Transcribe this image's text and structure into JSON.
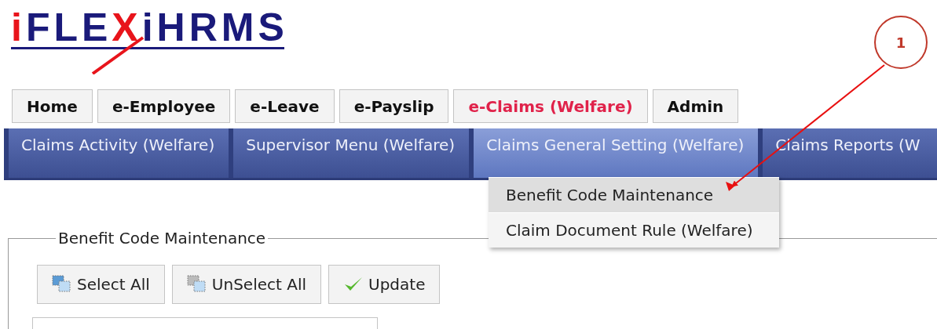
{
  "logo": {
    "parts": [
      {
        "text": "i",
        "color": "#e8141b"
      },
      {
        "text": "FLE",
        "color": "#1a1a7a"
      },
      {
        "text": "X",
        "color": "#e8141b"
      },
      {
        "text": "iHRMS",
        "color": "#1a1a7a"
      }
    ]
  },
  "main_tabs": [
    {
      "label": "Home",
      "selected": false
    },
    {
      "label": "e-Employee",
      "selected": false
    },
    {
      "label": "e-Leave",
      "selected": false
    },
    {
      "label": "e-Payslip",
      "selected": false
    },
    {
      "label": "e-Claims (Welfare)",
      "selected": true
    },
    {
      "label": "Admin",
      "selected": false
    }
  ],
  "sub_menu": [
    {
      "label": "Claims Activity (Welfare)",
      "selected": false
    },
    {
      "label": "Supervisor Menu (Welfare)",
      "selected": false
    },
    {
      "label": "Claims General Setting (Welfare)",
      "selected": true
    },
    {
      "label": "Claims Reports (W",
      "selected": false
    }
  ],
  "dropdown": [
    {
      "label": "Benefit Code Maintenance",
      "selected": true
    },
    {
      "label": "Claim Document Rule (Welfare)",
      "selected": false
    }
  ],
  "panel": {
    "legend": "Benefit Code Maintenance",
    "buttons": [
      {
        "label": "Select All",
        "kind": "select"
      },
      {
        "label": "UnSelect All",
        "kind": "unselect"
      },
      {
        "label": "Update",
        "kind": "update"
      }
    ]
  },
  "callout": {
    "number": "1"
  }
}
